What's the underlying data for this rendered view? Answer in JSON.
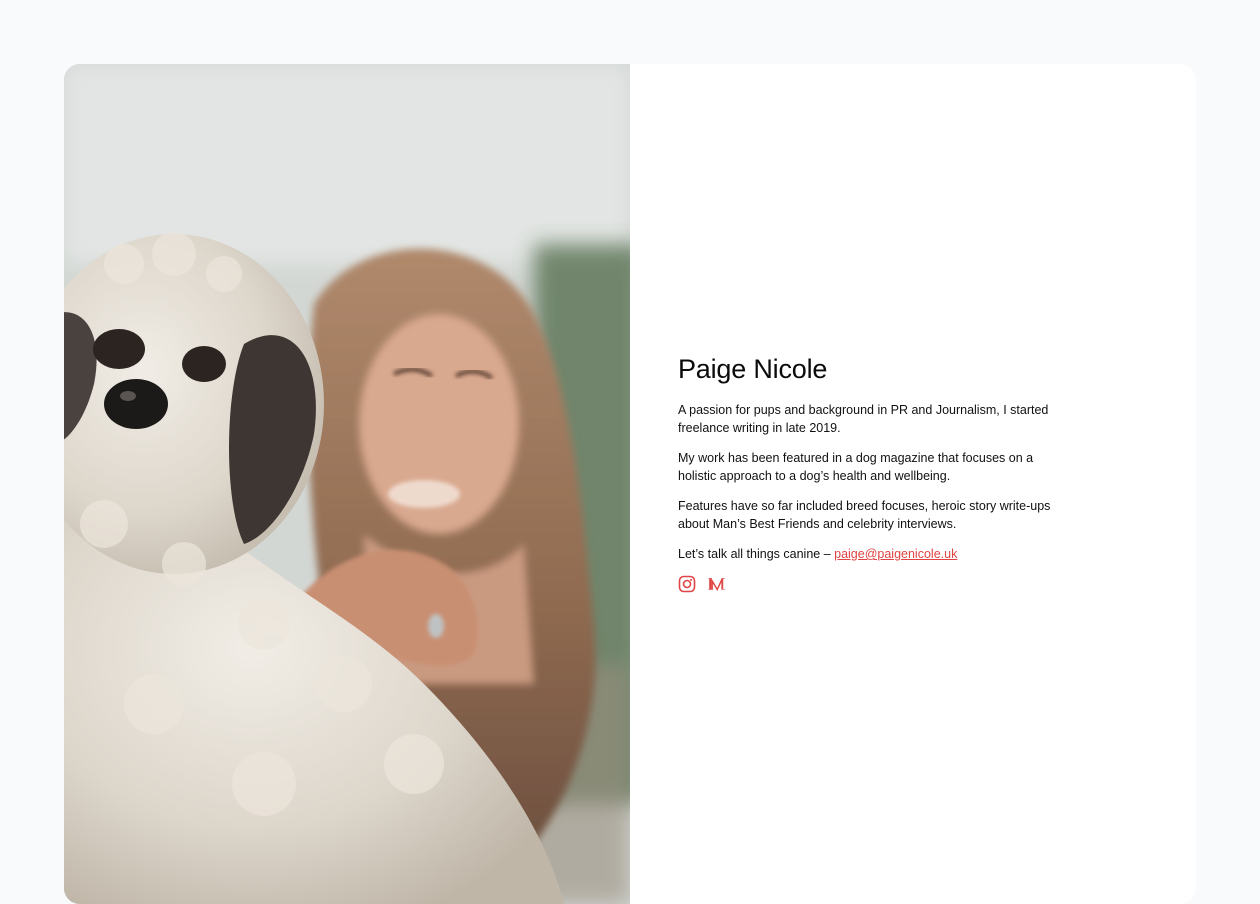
{
  "profile": {
    "name": "Paige Nicole",
    "photo_alt": "Paige Nicole hugging a fluffy cockapoo dog",
    "bio": [
      "A passion for pups and background in PR and Journalism, I started freelance writing in late 2019.",
      "My work has been featured in a dog magazine that focuses on a holistic approach to a dog’s health and wellbeing.",
      "Features have so far included breed focuses, heroic story write-ups about Man’s Best Friends and celebrity interviews."
    ],
    "contact_prefix": "Let’s talk all things canine – ",
    "email": "paige@paigenicole.uk",
    "email_href": "mailto:paige@paigenicole.uk"
  },
  "social": [
    {
      "name": "Instagram",
      "icon": "instagram-icon"
    },
    {
      "name": "Medium",
      "icon": "medium-icon"
    }
  ],
  "colors": {
    "page_background": "#f9fafb",
    "card_background": "#ffffff",
    "accent": "#e04444",
    "text": "#111111"
  }
}
